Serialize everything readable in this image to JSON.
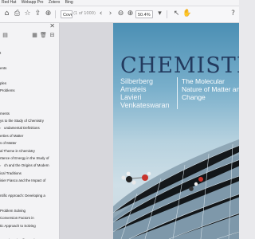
{
  "bookmarks_bar": {
    "items": [
      "Red Hat",
      "Webapp Pro",
      "Zotero",
      "Bing"
    ]
  },
  "toolbar": {
    "page_current": "Cover",
    "page_total": "(1 of 1000)",
    "zoom": "50.4%",
    "icons": [
      "home-icon",
      "print-icon",
      "bookmark-icon",
      "upload-icon",
      "download-icon",
      "prev-page-icon",
      "next-page-icon",
      "zoom-out-icon",
      "zoom-in-icon",
      "select-cursor-icon",
      "hand-tool-icon",
      "help-icon"
    ]
  },
  "sidebar": {
    "tool_icons": [
      "expand-icon",
      "collapse-icon",
      "delete-icon",
      "tag-icon"
    ],
    "items": [
      {
        "label": "",
        "caret": false
      },
      {
        "label": "t",
        "caret": false
      },
      {
        "label": "",
        "caret": false
      },
      {
        "label": "ents",
        "caret": false
      },
      {
        "label": "",
        "caret": false
      },
      {
        "label": "ples",
        "caret": false
      },
      {
        "label": "Problems",
        "caret": false
      },
      {
        "label": "",
        "caret": false
      },
      {
        "label": "",
        "caret": false
      },
      {
        "label": "ments",
        "caret": false
      },
      {
        "label": "ys to the Study of Chemistry",
        "caret": false
      },
      {
        "label": "undamental Definitions",
        "caret": true
      },
      {
        "label": "erties of Matter",
        "caret": false
      },
      {
        "label": "s of Matter",
        "caret": false
      },
      {
        "label": "al Theme in Chemistry",
        "caret": false
      },
      {
        "label": "rtance of Energy in the Study of",
        "caret": false
      },
      {
        "label": "ch and the Origins of Modern",
        "caret": true
      },
      {
        "label": "ical Traditions",
        "caret": false
      },
      {
        "label": "isier Fiasco and the Impact of",
        "caret": false
      },
      {
        "label": "",
        "caret": false
      },
      {
        "label": "ntific Approach: Developing a",
        "caret": false
      },
      {
        "label": "",
        "caret": false
      },
      {
        "label": "Problem Solving",
        "caret": false
      },
      {
        "label": "Conversion Factors in",
        "caret": false
      },
      {
        "label": "tic Approach to Solving",
        "caret": false
      },
      {
        "label": "",
        "caret": false
      },
      {
        "label": "ment in Scientific Study",
        "caret": false
      }
    ]
  },
  "cover": {
    "title": "CHEMISTRY",
    "authors": [
      "Silberberg",
      "Amateis",
      "Lavieri",
      "Venkateswaran"
    ],
    "subtitle": "The Molecular Nature of Matter and Change"
  },
  "colors": {
    "title": "#233a5e",
    "sky_top": "#4b8fb4"
  }
}
